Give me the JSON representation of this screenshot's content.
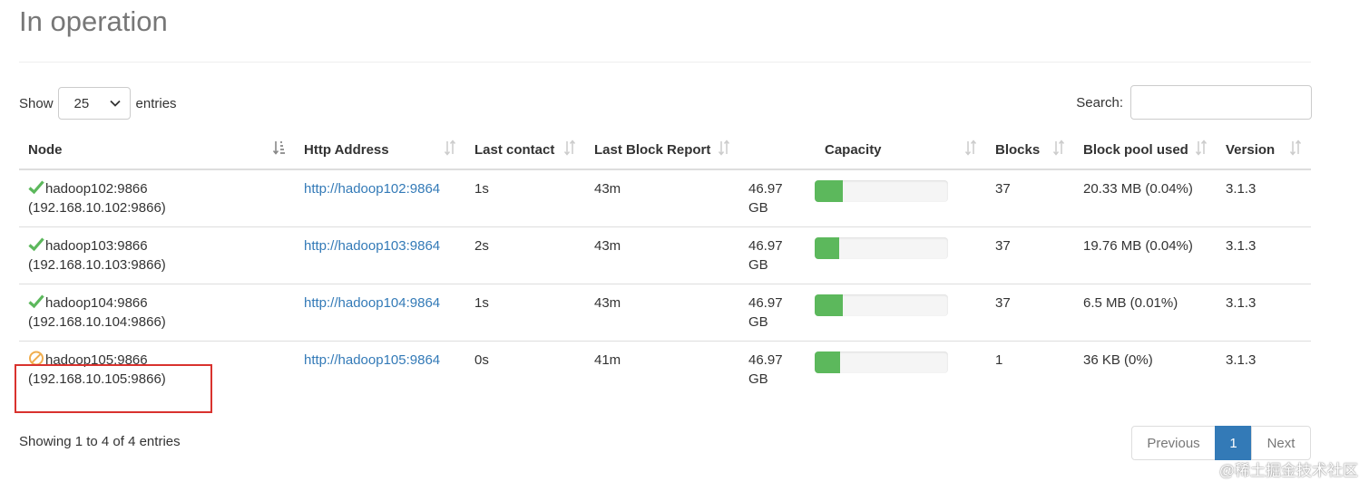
{
  "page": {
    "title": "In operation"
  },
  "length_control": {
    "prefix": "Show",
    "value": "25",
    "suffix": "entries"
  },
  "search": {
    "label": "Search:",
    "value": ""
  },
  "columns": [
    "Node",
    "Http Address",
    "Last contact",
    "Last Block Report",
    "Capacity",
    "Blocks",
    "Block pool used",
    "Version"
  ],
  "rows": [
    {
      "status": "in-service",
      "node": "hadoop102:9866",
      "ip": "(192.168.10.102:9866)",
      "http": "http://hadoop102:9864",
      "last_contact": "1s",
      "last_block_report": "43m",
      "capacity": "46.97 GB",
      "capacity_fill_pct": 21,
      "blocks": "37",
      "block_pool_used": "20.33 MB (0.04%)",
      "version": "3.1.3"
    },
    {
      "status": "in-service",
      "node": "hadoop103:9866",
      "ip": "(192.168.10.103:9866)",
      "http": "http://hadoop103:9864",
      "last_contact": "2s",
      "last_block_report": "43m",
      "capacity": "46.97 GB",
      "capacity_fill_pct": 18,
      "blocks": "37",
      "block_pool_used": "19.76 MB (0.04%)",
      "version": "3.1.3"
    },
    {
      "status": "in-service",
      "node": "hadoop104:9866",
      "ip": "(192.168.10.104:9866)",
      "http": "http://hadoop104:9864",
      "last_contact": "1s",
      "last_block_report": "43m",
      "capacity": "46.97 GB",
      "capacity_fill_pct": 21,
      "blocks": "37",
      "block_pool_used": "6.5 MB (0.01%)",
      "version": "3.1.3"
    },
    {
      "status": "decommissioned",
      "node": "hadoop105:9866",
      "ip": "(192.168.10.105:9866)",
      "http": "http://hadoop105:9864",
      "last_contact": "0s",
      "last_block_report": "41m",
      "capacity": "46.97 GB",
      "capacity_fill_pct": 19,
      "blocks": "1",
      "block_pool_used": "36 KB (0%)",
      "version": "3.1.3"
    }
  ],
  "footer": {
    "info": "Showing 1 to 4 of 4 entries",
    "previous": "Previous",
    "current_page": "1",
    "next": "Next"
  },
  "watermark": "@稀土掘金技术社区",
  "colors": {
    "ok": "#5cb85c",
    "warn": "#f0ad4e",
    "link": "#337ab7",
    "highlight": "#d9322e"
  },
  "icons": {
    "in-service": "check-icon",
    "decommissioned": "ban-icon"
  }
}
